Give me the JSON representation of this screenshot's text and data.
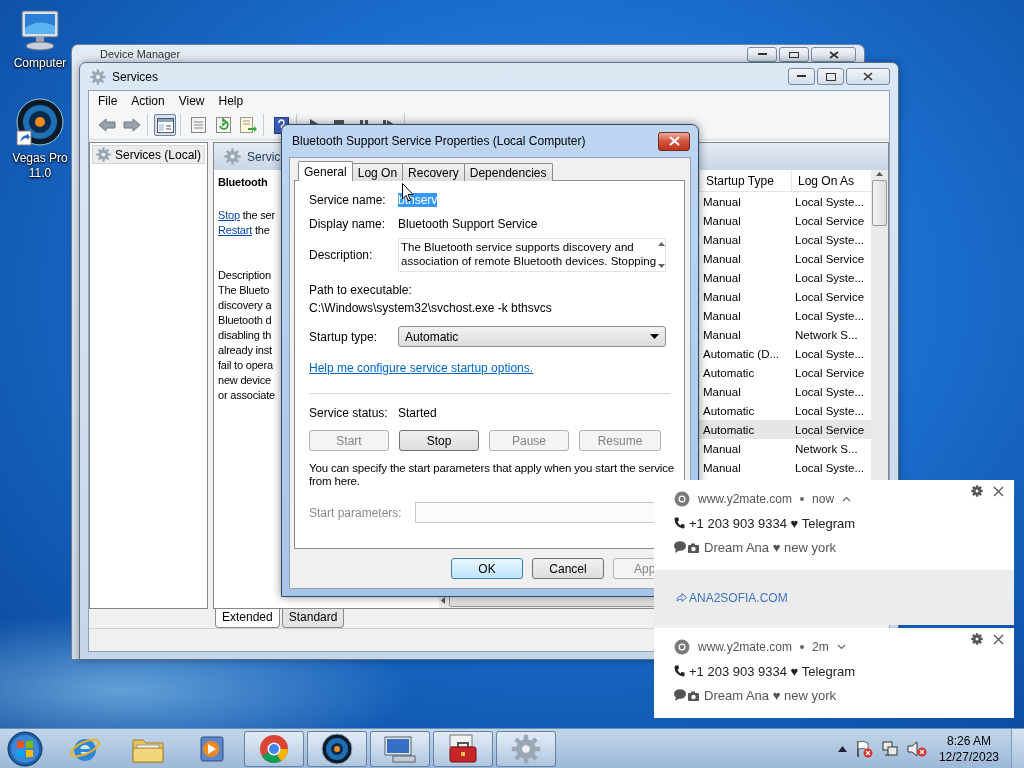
{
  "desktop_icons": [
    {
      "kind": "computer",
      "label": "Computer"
    },
    {
      "kind": "vegas",
      "label": "Vegas Pro 11.0"
    }
  ],
  "background_window": {
    "title": "Device Manager"
  },
  "services_window": {
    "title": "Services",
    "menu": [
      "File",
      "Action",
      "View",
      "Help"
    ],
    "toolbar_groups": [
      [
        {
          "kind": "back",
          "pressed": false
        },
        {
          "kind": "forward",
          "pressed": false
        }
      ],
      [
        {
          "kind": "tree",
          "pressed": true
        }
      ],
      [
        {
          "kind": "properties",
          "pressed": false
        },
        {
          "kind": "refresh",
          "pressed": false
        },
        {
          "kind": "export",
          "pressed": false
        }
      ],
      [
        {
          "kind": "help",
          "pressed": false
        }
      ],
      [
        {
          "kind": "play",
          "pressed": false
        },
        {
          "kind": "stop",
          "pressed": false
        },
        {
          "kind": "pause",
          "pressed": false
        },
        {
          "kind": "restart",
          "pressed": false
        }
      ]
    ],
    "tree": [
      {
        "label": "Services (Local)",
        "selected": true
      }
    ],
    "pane_title": "Servic",
    "detail": {
      "name": "Bluetooth",
      "actions": [
        {
          "link": "Stop",
          "text": "the ser"
        },
        {
          "link": "Restart",
          "text": "the"
        }
      ],
      "description_label": "Description",
      "description_lines": [
        "The Blueto",
        "discovery a",
        "Bluetooth d",
        "disabling th",
        "already inst",
        "fail to opera",
        "new device",
        "or associate"
      ]
    },
    "list": {
      "columns": [
        "Startup Type",
        "Log On As"
      ],
      "rows": [
        {
          "startup_type": "Manual",
          "log_on_as": "Local Syste...",
          "selected": false
        },
        {
          "startup_type": "Manual",
          "log_on_as": "Local Service",
          "selected": false
        },
        {
          "startup_type": "Manual",
          "log_on_as": "Local Syste...",
          "selected": false
        },
        {
          "startup_type": "Manual",
          "log_on_as": "Local Service",
          "selected": false
        },
        {
          "startup_type": "Manual",
          "log_on_as": "Local Syste...",
          "selected": false
        },
        {
          "startup_type": "Manual",
          "log_on_as": "Local Service",
          "selected": false
        },
        {
          "startup_type": "Manual",
          "log_on_as": "Local Syste...",
          "selected": false
        },
        {
          "startup_type": "Manual",
          "log_on_as": "Network S...",
          "selected": false
        },
        {
          "startup_type": "Automatic (D...",
          "log_on_as": "Local Syste...",
          "selected": false
        },
        {
          "startup_type": "Automatic",
          "log_on_as": "Local Service",
          "selected": false
        },
        {
          "startup_type": "Manual",
          "log_on_as": "Local Syste...",
          "selected": false
        },
        {
          "startup_type": "Automatic",
          "log_on_as": "Local Syste...",
          "selected": false
        },
        {
          "startup_type": "Automatic",
          "log_on_as": "Local Service",
          "selected": true
        },
        {
          "startup_type": "Manual",
          "log_on_as": "Network S...",
          "selected": false
        },
        {
          "startup_type": "Manual",
          "log_on_as": "Local Syste...",
          "selected": false
        }
      ]
    },
    "view_tabs": [
      {
        "label": "Extended",
        "selected": true
      },
      {
        "label": "Standard",
        "selected": false
      }
    ]
  },
  "dialog": {
    "title": "Bluetooth Support Service Properties (Local Computer)",
    "tabs": [
      {
        "label": "General",
        "selected": true
      },
      {
        "label": "Log On",
        "selected": false
      },
      {
        "label": "Recovery",
        "selected": false
      },
      {
        "label": "Dependencies",
        "selected": false
      }
    ],
    "service_name_label": "Service name:",
    "service_name": "bthserv",
    "service_name_highlighted": true,
    "display_name_label": "Display name:",
    "display_name": "Bluetooth Support Service",
    "description_label": "Description:",
    "description_lines": [
      "The Bluetooth service supports discovery and",
      "association of remote Bluetooth devices.  Stopping"
    ],
    "path_label": "Path to executable:",
    "path": "C:\\Windows\\system32\\svchost.exe -k bthsvcs",
    "startup_label": "Startup type:",
    "startup_value": "Automatic",
    "help_link": "Help me configure service startup options.",
    "status_label": "Service status:",
    "status": "Started",
    "service_buttons": [
      {
        "label": "Start",
        "disabled": true
      },
      {
        "label": "Stop",
        "disabled": false
      },
      {
        "label": "Pause",
        "disabled": true
      },
      {
        "label": "Resume",
        "disabled": true
      }
    ],
    "params_note": "You can specify the start parameters that apply when you start the service from here.",
    "params_label": "Start parameters:",
    "params_disabled": true,
    "buttons": [
      {
        "label": "OK",
        "default": true,
        "disabled": false
      },
      {
        "label": "Cancel",
        "default": false,
        "disabled": false
      },
      {
        "label": "App",
        "default": false,
        "disabled": true
      }
    ]
  },
  "notifications": [
    {
      "source": "www.y2mate.com",
      "time": "now",
      "expanded": true,
      "line_1": "+1 203 903 9334 ♥ Telegram",
      "line_2": "Dream Ana ♥ new york",
      "link": "ANA2SOFIA.COM"
    },
    {
      "source": "www.y2mate.com",
      "time": "2m",
      "expanded": false,
      "line_1": "+1 203 903 9334 ♥ Telegram",
      "line_2": "Dream Ana ♥ new york"
    }
  ],
  "taskbar": {
    "apps": [
      {
        "kind": "ie",
        "running": false
      },
      {
        "kind": "explorer",
        "running": false
      },
      {
        "kind": "media",
        "running": false
      },
      {
        "kind": "chrome",
        "running": true
      },
      {
        "kind": "vegas",
        "running": true
      },
      {
        "kind": "remote",
        "running": true
      },
      {
        "kind": "toolbox",
        "running": true
      },
      {
        "kind": "services",
        "running": true
      }
    ],
    "time": "8:26 AM",
    "date": "12/27/2023"
  }
}
